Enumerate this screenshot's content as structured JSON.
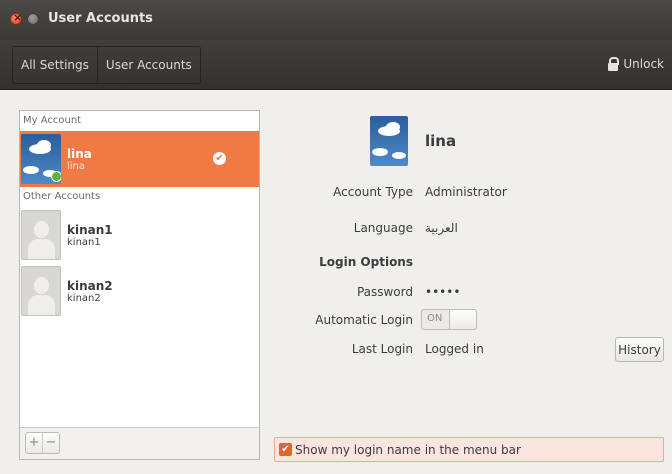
{
  "window": {
    "title": "User Accounts"
  },
  "toolbar": {
    "breadcrumbs": [
      "All Settings",
      "User Accounts"
    ],
    "unlock_label": "Unlock"
  },
  "accounts_panel": {
    "my_account_header": "My Account",
    "other_accounts_header": "Other Accounts",
    "my_account": {
      "name": "lina",
      "username": "lina"
    },
    "others": [
      {
        "name": "kinan1",
        "username": "kinan1"
      },
      {
        "name": "kinan2",
        "username": "kinan2"
      }
    ],
    "add_symbol": "+",
    "remove_symbol": "−"
  },
  "details": {
    "name": "lina",
    "account_type_label": "Account Type",
    "account_type_value": "Administrator",
    "language_label": "Language",
    "language_value": "العربية",
    "login_options_heading": "Login Options",
    "password_label": "Password",
    "password_value": "•••••",
    "auto_login_label": "Automatic Login",
    "auto_login_state": "ON",
    "last_login_label": "Last Login",
    "last_login_value": "Logged in",
    "history_button": "History"
  },
  "show_login_name": {
    "label": "Show my login name in the menu bar",
    "checked": true
  },
  "colors": {
    "selection": "#ef7a43",
    "titlebar": "#3b3a37",
    "checkbox": "#e0662e"
  }
}
